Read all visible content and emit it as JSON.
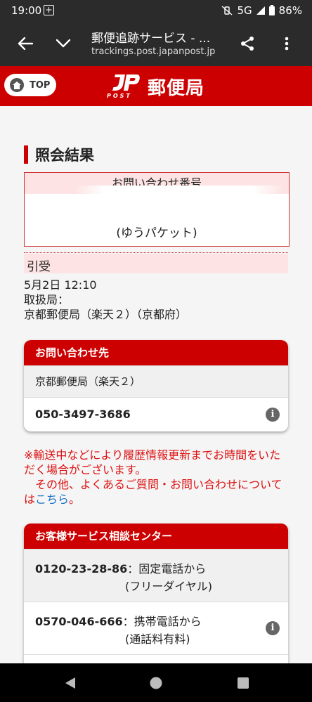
{
  "status_bar": {
    "time": "19:00",
    "network": "5G",
    "battery": "86%"
  },
  "browser": {
    "title": "郵便追跡サービス - ...",
    "url": "trackings.post.japanpost.jp"
  },
  "header": {
    "top_label": "TOP",
    "brand_name": "郵便局",
    "logo_text": "POST"
  },
  "result": {
    "heading": "照会結果",
    "inquiry_label": "お問い合わせ番号",
    "service_type": "(ゆうパケット)"
  },
  "event": {
    "status": "引受",
    "datetime": "5月2日 12:10",
    "office_label": "取扱局：",
    "office": "京都郵便局（楽天２）（京都府）"
  },
  "contact": {
    "heading": "お問い合わせ先",
    "office_name": "京都郵便局（楽天２）",
    "phone": "050-3497-3686"
  },
  "notice": {
    "line1": "※輸送中などにより履歴情報更新までお時間をいただく場合がございます。",
    "line2_prefix": "　その他、よくあるご質問・お問い合わせについては",
    "link": "こちら",
    "line2_suffix": "。"
  },
  "service_center": {
    "heading": "お客様サービス相談センター",
    "rows": [
      {
        "number": "0120-23-28-86",
        "desc": "：固定電話から",
        "note": "(フリーダイヤル)"
      },
      {
        "number": "0570-046-666",
        "desc": "：携帯電話から",
        "note": "(通話料有料)"
      }
    ]
  },
  "colors": {
    "brand_red": "#cc0000",
    "pink": "#fde3e3",
    "link_blue": "#1a73c8",
    "notice_red": "#dd1111"
  }
}
